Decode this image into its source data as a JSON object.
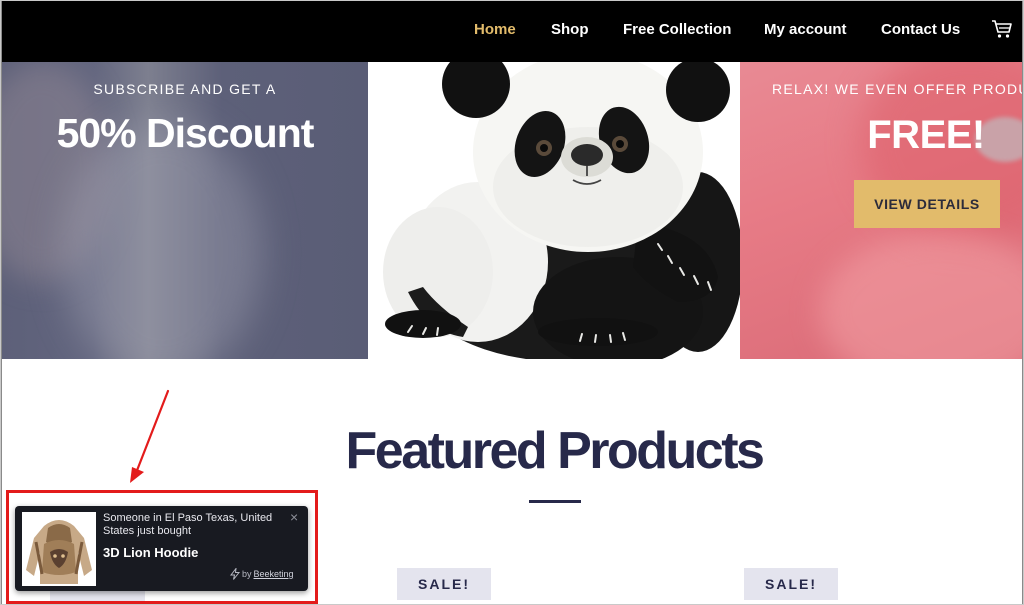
{
  "nav": {
    "items": [
      {
        "label": "Home",
        "active": true
      },
      {
        "label": "Shop",
        "active": false
      },
      {
        "label": "Free Collection",
        "active": false
      },
      {
        "label": "My account",
        "active": false
      },
      {
        "label": "Contact Us",
        "active": false
      }
    ],
    "cart_icon": "shopping-cart-icon"
  },
  "hero": {
    "left": {
      "eyebrow": "SUBSCRIBE AND GET A",
      "headline": "50% Discount"
    },
    "center": {
      "image": "panda-photo"
    },
    "right": {
      "eyebrow": "RELAX! WE EVEN OFFER PRODUC",
      "headline": "FREE!",
      "button_label": "VIEW DETAILS"
    }
  },
  "featured": {
    "title": "Featured Products",
    "badges": [
      "SALE!",
      "SALE!"
    ]
  },
  "popup": {
    "message": "Someone in El Paso Texas, United States just bought",
    "product": "3D Lion Hoodie",
    "close_icon": "×",
    "powered_by": "by",
    "brand": "Beeketing"
  },
  "colors": {
    "nav_bg": "#000000",
    "accent_gold": "#e2bb6b",
    "heading_navy": "#27294a",
    "badge_bg": "#e4e4ee",
    "popup_bg": "#181a21",
    "annotation_red": "#e31b1b"
  }
}
